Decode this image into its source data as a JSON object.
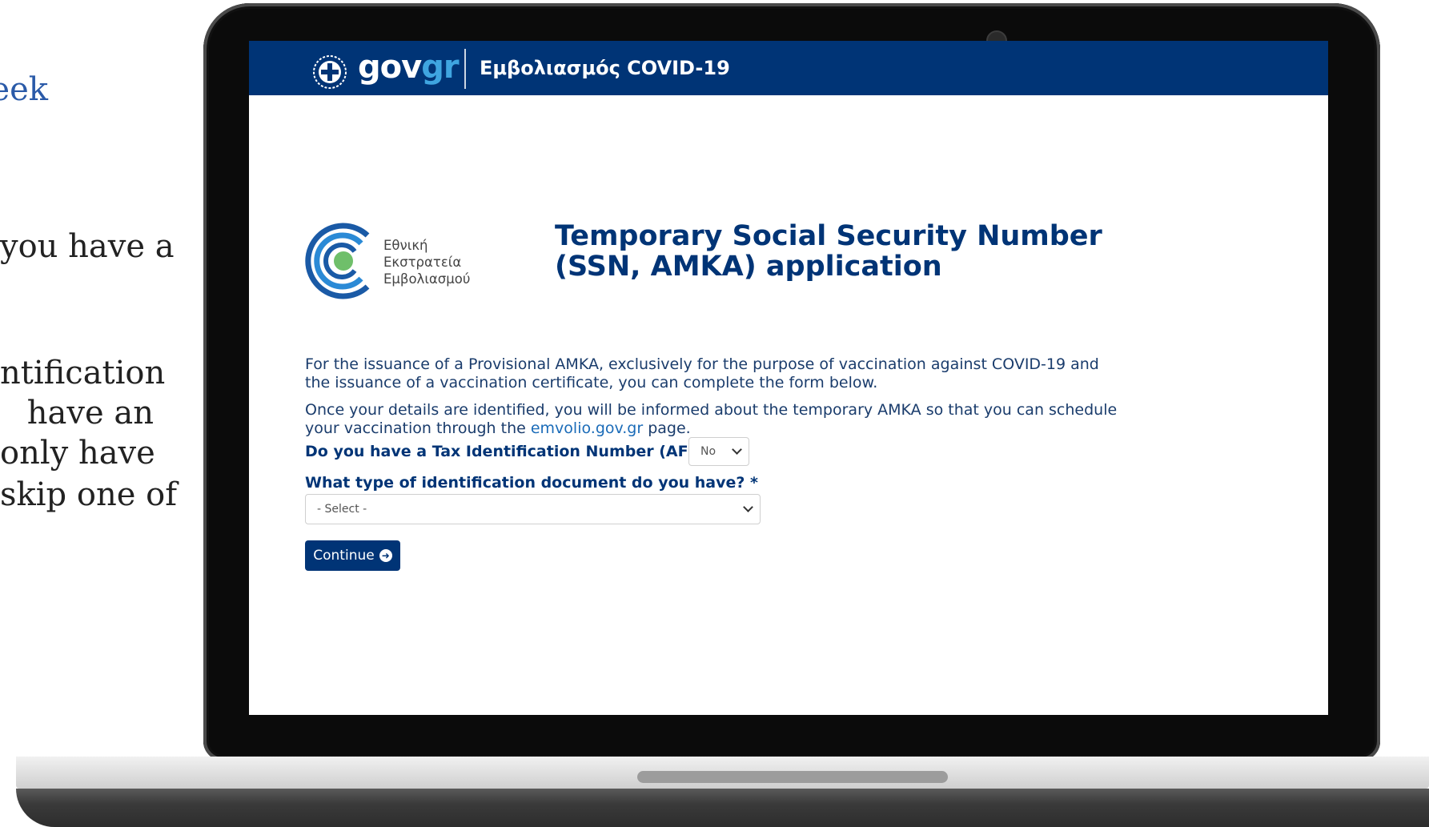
{
  "side_article": {
    "lines": [
      "eek",
      "you have a",
      "ntification",
      "have  an",
      "only have",
      "skip one of"
    ]
  },
  "header": {
    "logo_part1": "gov",
    "logo_part2": "gr",
    "app_title": "Εμβολιασμός COVID-19"
  },
  "campaign": {
    "line1": "Εθνική",
    "line2": "Εκστρατεία",
    "line3": "Εμβολιασμού"
  },
  "page": {
    "title": "Temporary Social Security Number (SSN, AMKA) application",
    "paragraph1": "For the issuance of a Provisional AMKA, exclusively for the purpose of vaccination against COVID-19 and the issuance of a vaccination certificate, you can complete the form below.",
    "paragraph2_before": "Once your details are identified, you will be informed about the temporary AMKA so that you can schedule your vaccination through the ",
    "paragraph2_link": "emvolio.gov.gr",
    "paragraph2_after": " page."
  },
  "form": {
    "afm_label": "Do you have a Tax Identification Number (AFM)? *",
    "afm_value": "No",
    "doc_label": "What type of identification document do you have? *",
    "doc_value": "- Select -",
    "continue_label": "Continue"
  },
  "colors": {
    "brand_blue": "#003476",
    "logo_accent": "#3fa5e0",
    "campaign_green": "#6fbf6a"
  }
}
